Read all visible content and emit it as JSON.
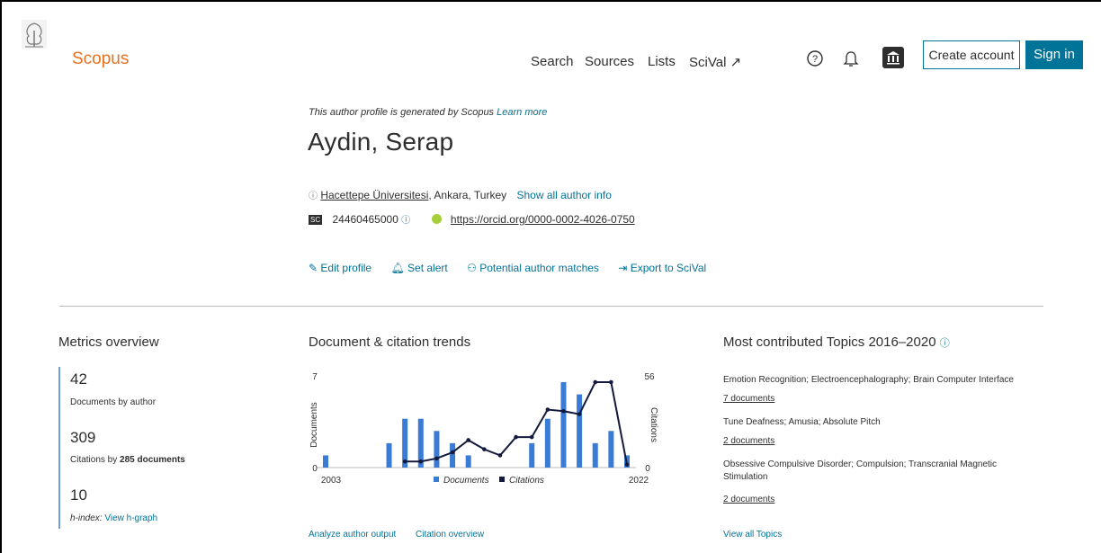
{
  "header": {
    "brand": "Scopus",
    "nav": [
      "Search",
      "Sources",
      "Lists",
      "SciVal ↗"
    ],
    "create_account": "Create account",
    "sign_in": "Sign in"
  },
  "profile": {
    "generated_note": "This author profile is generated by Scopus",
    "learn_more": "Learn more",
    "name": "Aydin, Serap",
    "affiliation_link": "Hacettepe Üniversitesi",
    "affiliation_rest": ", Ankara, Turkey",
    "show_all": "Show all author info",
    "sc_label": "SC",
    "scopus_id": "24460465000",
    "orcid": "https://orcid.org/0000-0002-4026-0750",
    "actions": [
      "Edit profile",
      "Set alert",
      "Potential author matches",
      "Export to SciVal"
    ]
  },
  "metrics": {
    "title": "Metrics overview",
    "documents": "42",
    "documents_label": "Documents by author",
    "citations": "309",
    "citations_label_prefix": "Citations by ",
    "citations_label_bold": "285 documents",
    "hindex": "10",
    "hindex_label": "h-index:",
    "hindex_link": "View h-graph"
  },
  "trends": {
    "title": "Document & citation trends",
    "bottom_links": [
      "Analyze author output",
      "Citation overview"
    ]
  },
  "topics": {
    "title": "Most contributed Topics 2016–2020",
    "items": [
      {
        "name": "Emotion Recognition; Electroencephalography; Brain Computer Interface",
        "docs": "7 documents"
      },
      {
        "name": "Tune Deafness; Amusia; Absolute Pitch",
        "docs": "2 documents"
      },
      {
        "name": "Obsessive Compulsive Disorder; Compulsion; Transcranial Magnetic Stimulation",
        "docs": "2 documents"
      }
    ],
    "view_all": "View all Topics"
  },
  "colors": {
    "accent": "#007398",
    "brand_orange": "#e9711c",
    "documents_bar": "#3a7bd5",
    "citations_line": "#141a3c"
  },
  "chart_data": {
    "type": "bar",
    "x": [
      2003,
      2004,
      2005,
      2006,
      2007,
      2008,
      2009,
      2010,
      2011,
      2012,
      2013,
      2014,
      2015,
      2016,
      2017,
      2018,
      2019,
      2020,
      2021,
      2022
    ],
    "x_tick_labels": [
      "2003",
      "2022"
    ],
    "series": [
      {
        "name": "Documents",
        "type": "bar",
        "axis": "left",
        "values": [
          1,
          0,
          0,
          0,
          2,
          4,
          4,
          3,
          2,
          1,
          0,
          0,
          0,
          2,
          4,
          7,
          6,
          2,
          3,
          1
        ]
      },
      {
        "name": "Citations",
        "type": "line",
        "axis": "right",
        "values": [
          null,
          null,
          null,
          null,
          null,
          4,
          4,
          6,
          10,
          18,
          12,
          8,
          20,
          20,
          38,
          37,
          35,
          56,
          56,
          2
        ]
      }
    ],
    "ylabel_left": "Documents",
    "ylabel_right": "Citations",
    "ylim_left": [
      0,
      7
    ],
    "ylim_right": [
      0,
      56
    ],
    "left_ticks": [
      "0",
      "7"
    ],
    "right_ticks": [
      "0",
      "56"
    ],
    "legend_position": "bottom-center"
  }
}
